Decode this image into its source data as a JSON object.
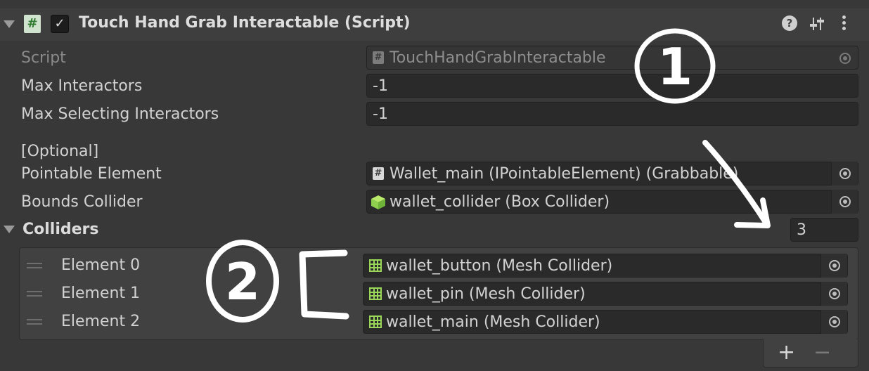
{
  "component": {
    "title": "Touch Hand Grab Interactable (Script)",
    "header_icons": [
      "help-icon",
      "preset-sliders-icon",
      "more-vertical-icon"
    ]
  },
  "fields": {
    "script": {
      "label": "Script",
      "value": "TouchHandGrabInteractable"
    },
    "max_interactors": {
      "label": "Max Interactors",
      "value": "-1"
    },
    "max_selecting_interactors": {
      "label": "Max Selecting Interactors",
      "value": "-1"
    },
    "optional_header": "[Optional]",
    "pointable_element": {
      "label": "Pointable Element",
      "value": "Wallet_main (IPointableElement) (Grabbable)"
    },
    "bounds_collider": {
      "label": "Bounds Collider",
      "value": "wallet_collider (Box Collider)"
    }
  },
  "colliders": {
    "label": "Colliders",
    "count": "3",
    "elements": [
      {
        "label": "Element 0",
        "value": "wallet_button (Mesh Collider)"
      },
      {
        "label": "Element 1",
        "value": "wallet_pin (Mesh Collider)"
      },
      {
        "label": "Element 2",
        "value": "wallet_main (Mesh Collider)"
      }
    ],
    "add_label": "+",
    "remove_label": "−"
  },
  "annotations": {
    "marker_1": "1",
    "marker_2": "2"
  },
  "colors": {
    "background": "#383838",
    "header": "#3e3e3e",
    "field": "#2a2a2a",
    "mesh_collider_icon": "#9bd85a",
    "box_collider_icon": "#8fd14f",
    "annotation_ink": "#ffffff"
  }
}
